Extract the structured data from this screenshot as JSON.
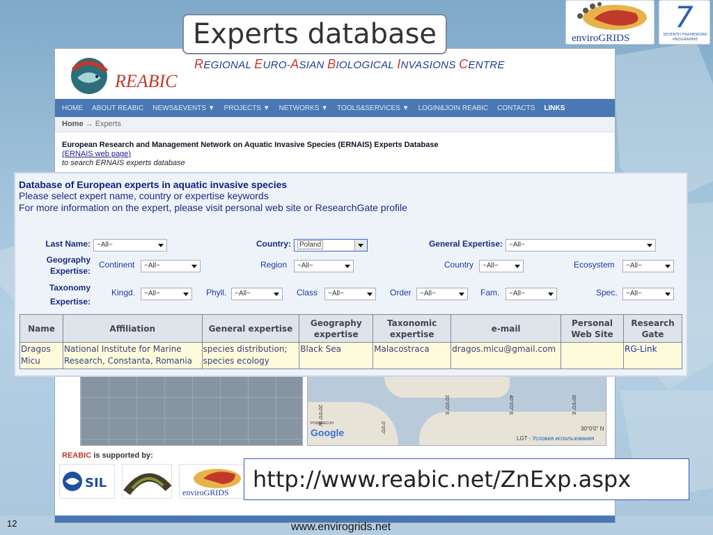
{
  "slide": {
    "title": "Experts database",
    "number": "12",
    "footer_site": "www.envirogrids.net",
    "url": "http://www.reabic.net/ZnExp.aspx"
  },
  "logos": {
    "envirogrids": "enviroGRIDS",
    "fp7_top": "SEVENTH FRAMEWORK",
    "fp7_bottom": "PROGRAMME",
    "fp7_numeral": "7"
  },
  "reabic": {
    "name": "REABIC",
    "subtitle_parts": [
      {
        "cap": "R",
        "rest": "EGIONAL "
      },
      {
        "cap": "E",
        "rest": "URO-"
      },
      {
        "cap": "A",
        "rest": "SIAN "
      },
      {
        "cap": "B",
        "rest": "IOLOGICAL "
      },
      {
        "cap": "I",
        "rest": "NVASIONS "
      },
      {
        "cap": "C",
        "rest": "ENTRE"
      }
    ],
    "nav": [
      "HOME",
      "ABOUT REABIC",
      "NEWS&EVENTS ▼",
      "PROJECTS ▼",
      "NETWORKS ▼",
      "TOOLS&SERVICES ▼",
      "LOGIN&JOIN REABIC",
      "CONTACTS",
      "LINKS"
    ],
    "breadcrumb_home": "Home",
    "breadcrumb_arrow": "→",
    "breadcrumb_current": "Experts",
    "ernais_title": "European Research and Management Network on Aquatic Invasive Species (ERNAIS) Experts Database",
    "ernais_link": "(ERNAIS web page)",
    "ernais_note": "to search ERNAIS experts database",
    "supported_brand": "REABIC",
    "supported_text": " is supported by:",
    "map_coords": [
      "20°0'0\" W",
      "0°0'0\"",
      "20°0'0\" E",
      "40°0'0\" E",
      "60°0'0\" E",
      "30°0'0\" N"
    ],
    "map_google": "Google",
    "map_powered": "POWERED BY",
    "map_lgt": "LGT - ",
    "map_terms": "Условия использования",
    "sponsor_sil": "SIL",
    "sponsor_enviro": "enviroGRIDS"
  },
  "panel": {
    "title": "Database of European experts in aquatic invasive species",
    "line1": "Please select expert name, country or expertise keywords",
    "line2": "For more information on the expert, please visit personal web site or ResearchGate profile",
    "lastname_label": "Last Name:",
    "lastname_value": "~All~",
    "country_label": "Country:",
    "country_value": "Poland",
    "general_label": "General Expertise:",
    "general_value": "~All~",
    "geo_label_1": "Geography",
    "geo_label_2": "Expertise:",
    "continent_label": "Continent",
    "continent_value": "~All~",
    "region_label": "Region",
    "region_value": "~All~",
    "geo_country_label": "Country",
    "geo_country_value": "~All~",
    "ecosystem_label": "Ecosystem",
    "ecosystem_value": "~All~",
    "tax_label_1": "Taxonomy",
    "tax_label_2": "Expertise:",
    "kingd_label": "Kingd.",
    "kingd_value": "~All~",
    "phyll_label": "Phyll.",
    "phyll_value": "~All~",
    "class_label": "Class",
    "class_value": "~All~",
    "order_label": "Order",
    "order_value": "~All~",
    "fam_label": "Fam.",
    "fam_value": "~All~",
    "spec_label": "Spec.",
    "spec_value": "~All~"
  },
  "table": {
    "headers": [
      "Name",
      "Affiliation",
      "General expertise",
      "Geography expertise",
      "Taxonomic expertise",
      "e-mail",
      "Personal Web Site",
      "Research Gate"
    ],
    "rows": [
      {
        "name_1": "Dragos",
        "name_2": "Micu",
        "affiliation_1": "National Institute for Marine",
        "affiliation_2": "Research, Constanta, Romania",
        "general_1": "species distribution;",
        "general_2": "species ecology",
        "geography": "Black Sea",
        "taxonomic": "Malacostraca",
        "email": "dragos.micu@gmail.com",
        "website": "",
        "research_gate": "RG-Link"
      }
    ]
  },
  "colors": {
    "nav_bar": "#4a78b5",
    "reabic_red": "#c0392b",
    "panel_text": "#1a2a80",
    "row_bg": "#fdfbdc"
  }
}
